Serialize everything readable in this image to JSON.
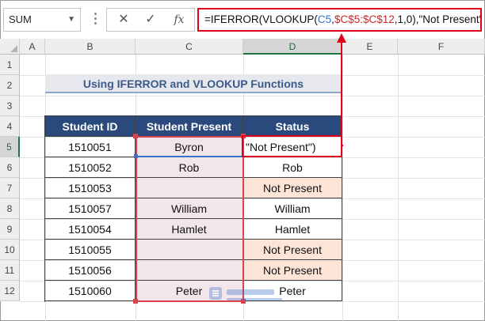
{
  "name_box": {
    "value": "SUM"
  },
  "formula_bar": {
    "cancel_glyph": "✕",
    "enter_glyph": "✓",
    "fx_glyph": "fx",
    "formula_prefix": "=IFERROR(VLOOKUP(",
    "formula_ref_cell": "C5",
    "formula_sep1": ",",
    "formula_ref_range": "$C$5:$C$12",
    "formula_suffix": ",1,0),\"Not Present\")"
  },
  "columns": [
    "A",
    "B",
    "C",
    "D",
    "E",
    "F"
  ],
  "rows": [
    "1",
    "2",
    "3",
    "4",
    "5",
    "6",
    "7",
    "8",
    "9",
    "10",
    "11",
    "12"
  ],
  "title": "Using IFERROR and VLOOKUP Functions",
  "table": {
    "headers": [
      "Student ID",
      "Student Present",
      "Status"
    ],
    "rows": [
      {
        "id": "1510051",
        "present": "Byron",
        "status": "\"Not Present\")"
      },
      {
        "id": "1510052",
        "present": "Rob",
        "status": "Rob"
      },
      {
        "id": "1510053",
        "present": "",
        "status": "Not Present"
      },
      {
        "id": "1510057",
        "present": "William",
        "status": "William"
      },
      {
        "id": "1510054",
        "present": "Hamlet",
        "status": "Hamlet"
      },
      {
        "id": "1510055",
        "present": "",
        "status": "Not Present"
      },
      {
        "id": "1510056",
        "present": "",
        "status": "Not Present"
      },
      {
        "id": "1510060",
        "present": "Peter",
        "status": "Peter"
      }
    ]
  },
  "colors": {
    "header_fill": "#2a4a7d",
    "not_present_fill": "#fce4d6",
    "highlight_red": "#e0001b",
    "selected_green": "#217346"
  }
}
